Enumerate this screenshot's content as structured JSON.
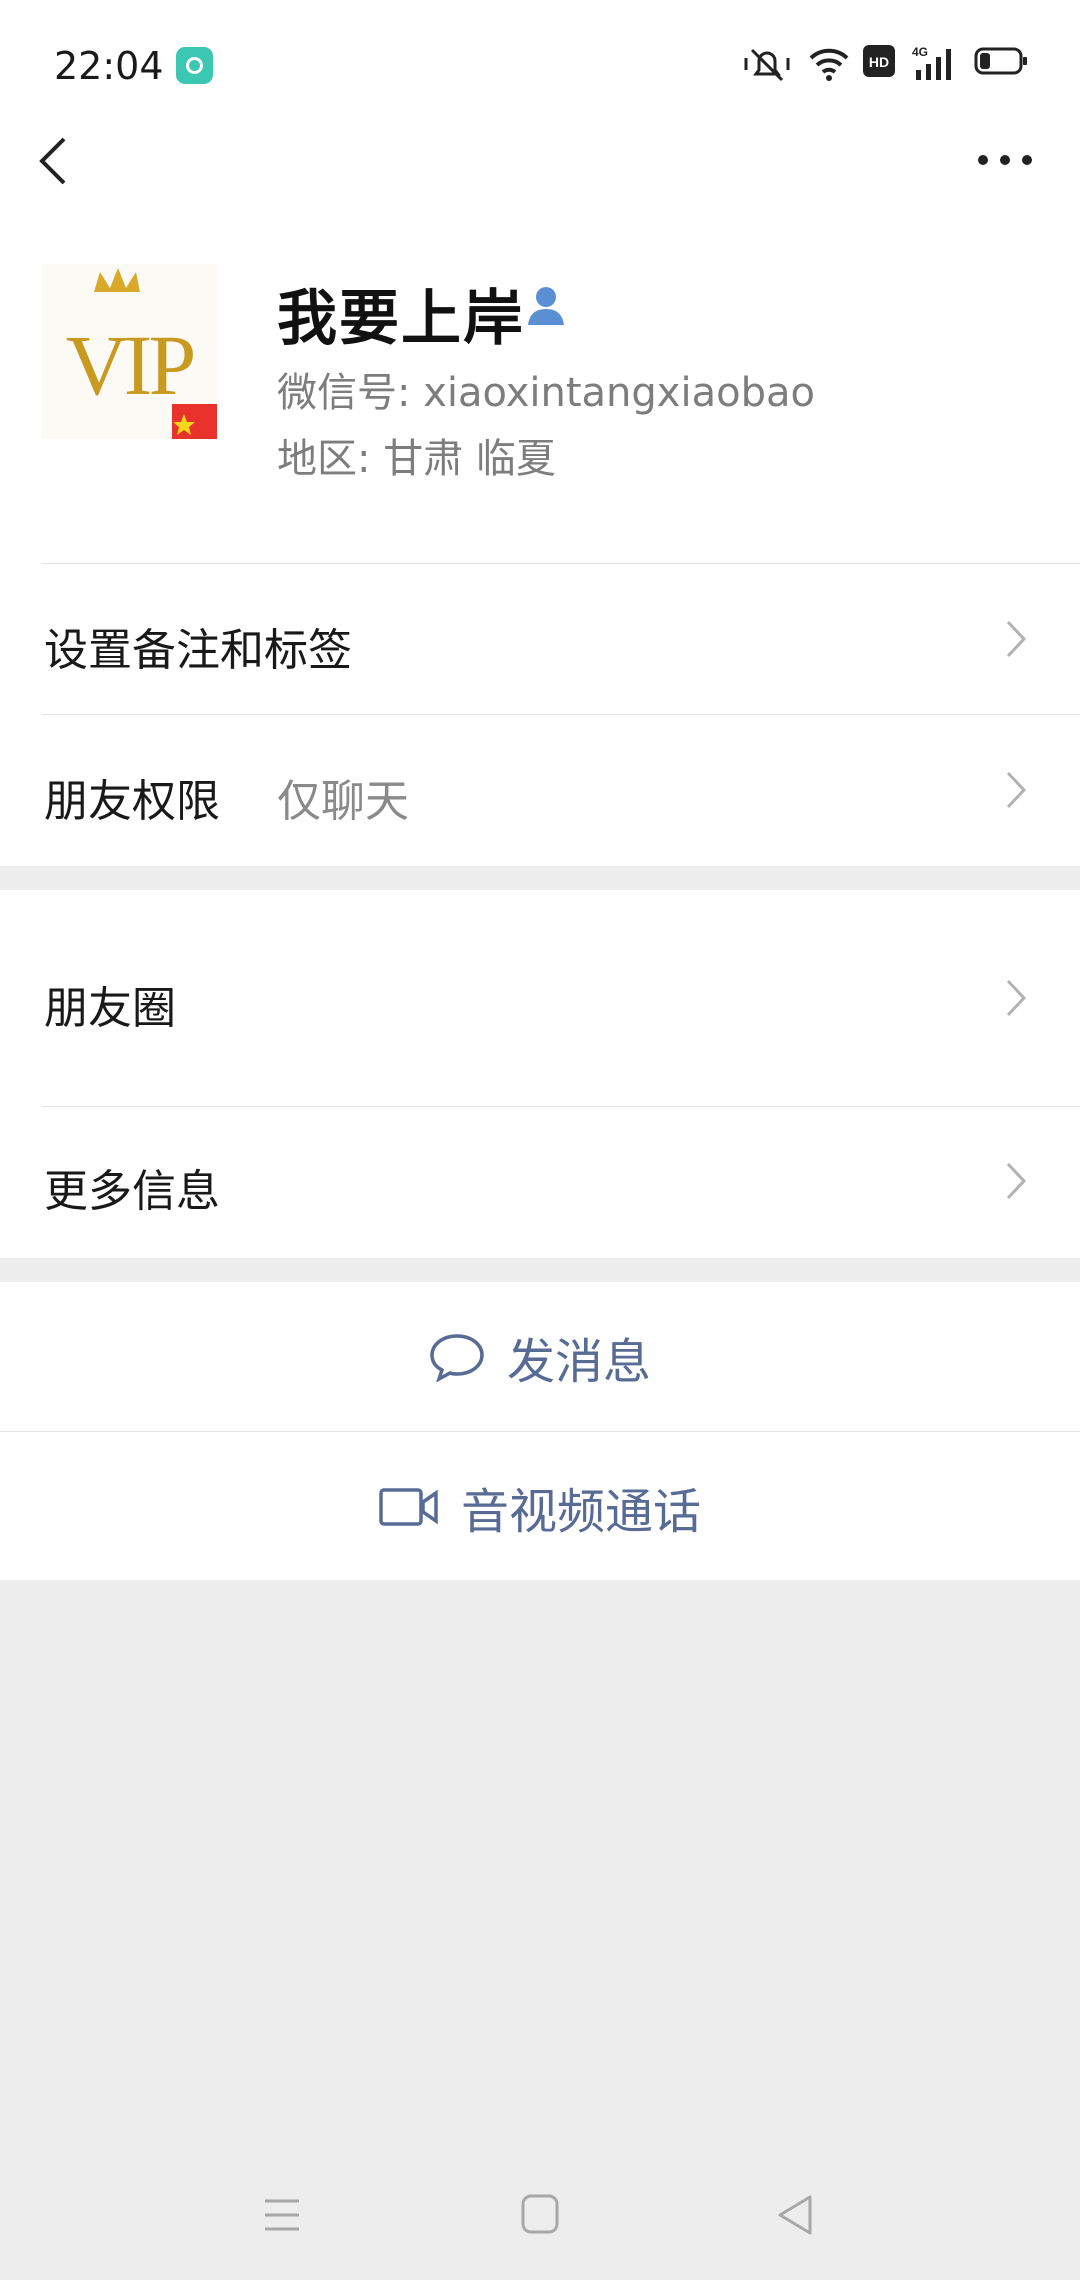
{
  "status_bar": {
    "time": "22:04"
  },
  "profile": {
    "name": "我要上岸",
    "wechat_id": "微信号: xiaoxintangxiaobao",
    "region": "地区: 甘肃  临夏",
    "avatar_text": "VIP"
  },
  "rows": {
    "remark_tags": "设置备注和标签",
    "permissions_label": "朋友权限",
    "permissions_value": "仅聊天",
    "moments": "朋友圈",
    "more_info": "更多信息"
  },
  "actions": {
    "send_message": "发消息",
    "video_call": "音视频通话"
  },
  "colors": {
    "link": "#576b95",
    "background": "#ededed"
  }
}
